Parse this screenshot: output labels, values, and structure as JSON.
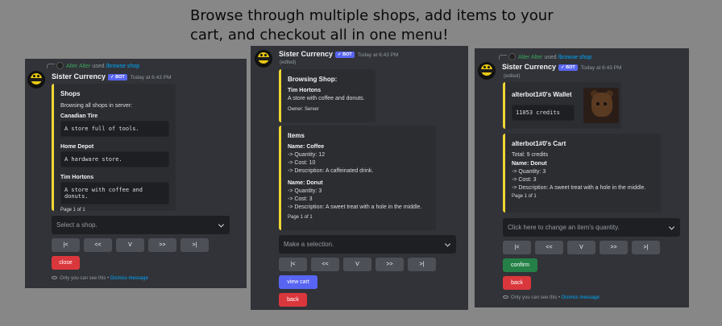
{
  "headline": {
    "line1": "Browse through multiple shops, add items to your",
    "line2": "cart, and checkout all in one menu!"
  },
  "colors": {
    "accent_embed": "#f0d635",
    "blurple": "#5865f2",
    "danger": "#da373c",
    "success": "#248046"
  },
  "panel1": {
    "reply_user": "Alter Alter",
    "reply_used": "used",
    "reply_command": "/browse shop",
    "bot_name": "Sister Currency",
    "bot_tag": "BOT",
    "time": "Today at 6:43 PM",
    "embed": {
      "title": "Shops",
      "description": "Browsing all shops in server:",
      "shops": [
        {
          "name": "Canadian Tire",
          "desc": "A store full of tools."
        },
        {
          "name": "Home Depot",
          "desc": "A hardware store."
        },
        {
          "name": "Tim Hortons",
          "desc": "A store with coffee and donuts."
        }
      ],
      "footer": "Page 1 of 1"
    },
    "select_placeholder": "Select a shop.",
    "nav": [
      "|<",
      "<<",
      "V",
      ">>",
      ">|"
    ],
    "close_label": "close",
    "notice": "Only you can see this",
    "notice_sep": " • ",
    "dismiss": "Dismiss message"
  },
  "panel2": {
    "bot_name": "Sister Currency",
    "bot_tag": "BOT",
    "time": "Today at 6:43 PM",
    "edited": "(edited)",
    "shop_embed": {
      "title": "Browsing Shop:",
      "shop_name": "Tim Hortons",
      "shop_desc": "A store with coffee and donuts.",
      "owner": "Owner: Server"
    },
    "items_embed": {
      "title": "Items",
      "items": [
        {
          "name": "Name: Coffee",
          "qty": "-> Quantity: 12",
          "cost": "-> Cost: 10",
          "desc": "-> Description: A caffeinated drink."
        },
        {
          "name": "Name: Donut",
          "qty": "-> Quantity: 3",
          "cost": "-> Cost: 3",
          "desc": "-> Description: A sweet treat with a hole in the middle."
        }
      ],
      "footer": "Page 1 of 1"
    },
    "select_placeholder": "Make a selection.",
    "nav": [
      "|<",
      "<<",
      "V",
      ">>",
      ">|"
    ],
    "view_cart_label": "view cart",
    "back_label": "back"
  },
  "panel3": {
    "reply_user": "Alter Alter",
    "reply_used": "used",
    "reply_command": "/browse shop",
    "bot_name": "Sister Currency",
    "bot_tag": "BOT",
    "time": "Today at 6:43 PM",
    "edited": "(edited)",
    "wallet_embed": {
      "title": "alterbot1#0's Wallet",
      "credits": "11053 credits"
    },
    "cart_embed": {
      "title": "alterbot1#0's Cart",
      "total": "Total: 9 credits",
      "item_name": "Name: Donut",
      "qty": "-> Quantity: 3",
      "cost": "-> Cost: 3",
      "desc": "-> Description: A sweet treat with a hole in the middle.",
      "footer": "Page 1 of 1"
    },
    "select_placeholder": "Click here to change an item's quantity.",
    "nav": [
      "|<",
      "<<",
      "V",
      ">>",
      ">|"
    ],
    "confirm_label": "confirm",
    "back_label": "back",
    "notice": "Only you can see this",
    "notice_sep": " • ",
    "dismiss": "Dismiss message"
  }
}
